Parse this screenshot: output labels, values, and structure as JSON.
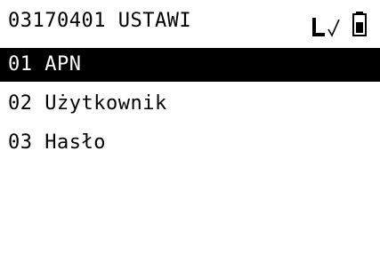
{
  "header": {
    "title": "03170401 USTAWI",
    "signal_icon": "signal-checkmark-icon",
    "battery_icon": "battery-full-icon"
  },
  "menu": {
    "items": [
      {
        "label": "01 APN",
        "selected": true
      },
      {
        "label": "02 Użytkownik",
        "selected": false
      },
      {
        "label": "03 Hasło",
        "selected": false
      }
    ]
  },
  "colors": {
    "background": "#ffffff",
    "text": "#000000",
    "highlight_bg": "#000000",
    "highlight_text": "#ffffff"
  }
}
